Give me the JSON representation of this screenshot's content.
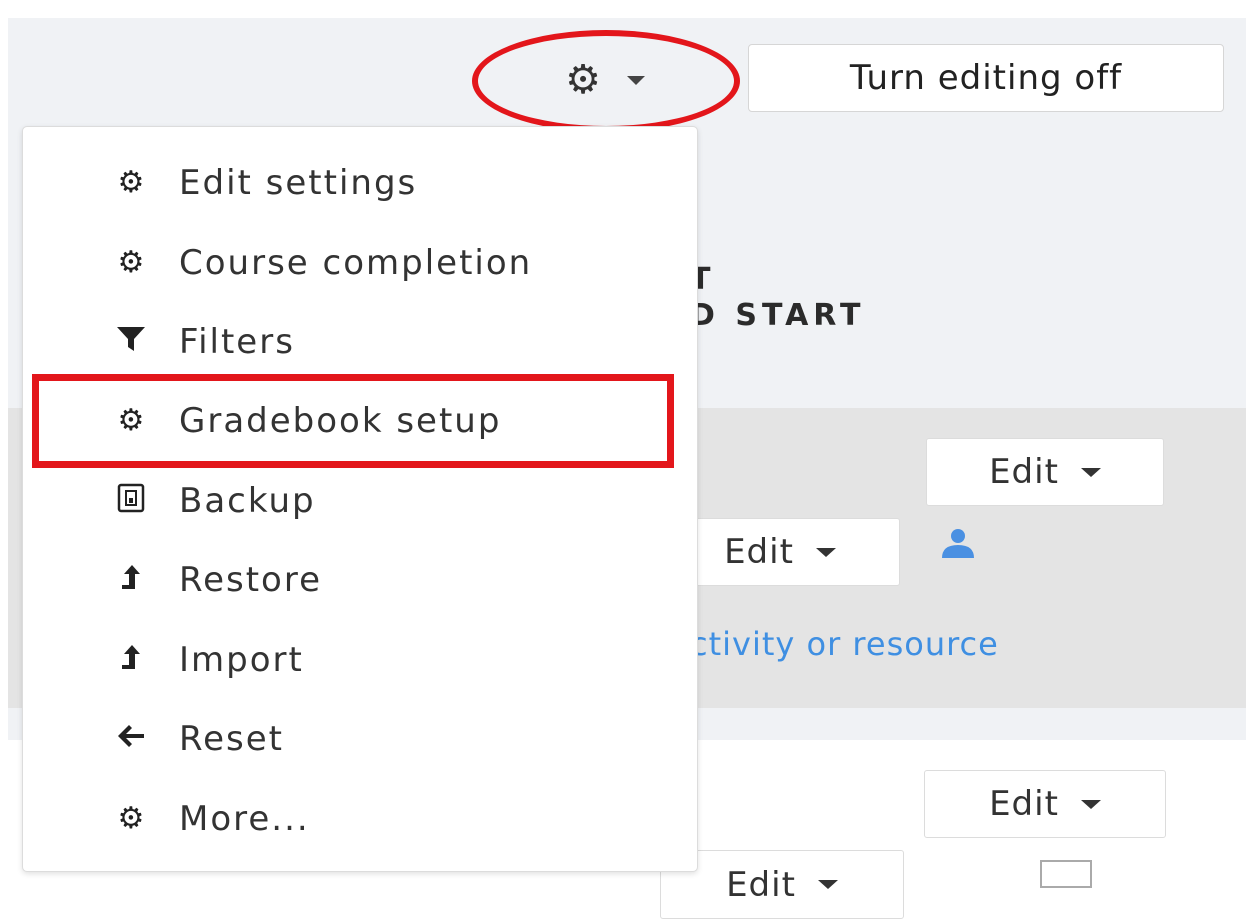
{
  "header": {
    "gear_icon": "gear-icon",
    "turn_editing_label": "Turn editing off"
  },
  "course": {
    "heading_line1": "T",
    "heading_line2": "D START",
    "edit_label": "Edit",
    "add_activity_text": "ctivity or resource"
  },
  "menu": {
    "items": [
      {
        "label": "Edit settings",
        "icon": "gear-icon"
      },
      {
        "label": "Course completion",
        "icon": "gear-icon"
      },
      {
        "label": "Filters",
        "icon": "filter-icon"
      },
      {
        "label": "Gradebook setup",
        "icon": "gear-icon"
      },
      {
        "label": "Backup",
        "icon": "backup-icon"
      },
      {
        "label": "Restore",
        "icon": "upload-icon"
      },
      {
        "label": "Import",
        "icon": "upload-icon"
      },
      {
        "label": "Reset",
        "icon": "arrow-left-icon"
      },
      {
        "label": "More...",
        "icon": "gear-icon"
      }
    ]
  },
  "colors": {
    "highlight": "#e3161b",
    "link": "#3f8fe2",
    "page_bg": "#f0f2f5"
  }
}
